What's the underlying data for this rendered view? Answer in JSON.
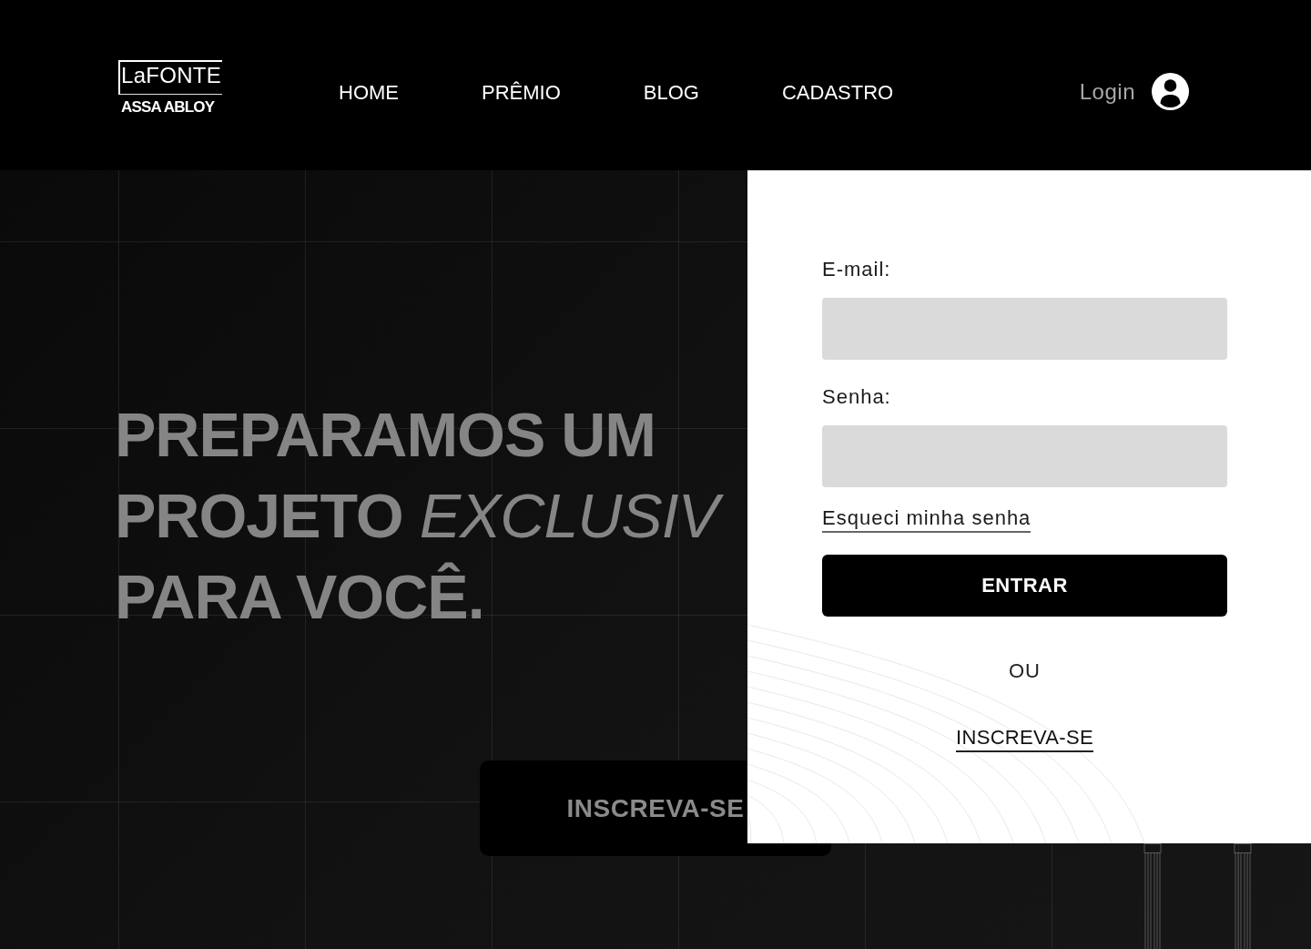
{
  "header": {
    "logo": {
      "name": "LaFONTE",
      "tagline": "ASSA ABLOY"
    },
    "nav": [
      "HOME",
      "PRÊMIO",
      "BLOG",
      "CADASTRO"
    ],
    "login_link": "Login"
  },
  "hero": {
    "heading_lines": [
      "PREPARAMOS UM",
      "PROJETO *EXCLUSIV*",
      "PARA VOCÊ."
    ],
    "button": "INSCREVA-SE"
  },
  "login_panel": {
    "fields": [
      {
        "label": "E-mail:"
      },
      {
        "label": "Senha:"
      }
    ],
    "forgot_password_link": "Esqueci minha senha",
    "submit_button": "ENTRAR",
    "separator": "OU",
    "signup_link": "INSCREVA-SE"
  }
}
